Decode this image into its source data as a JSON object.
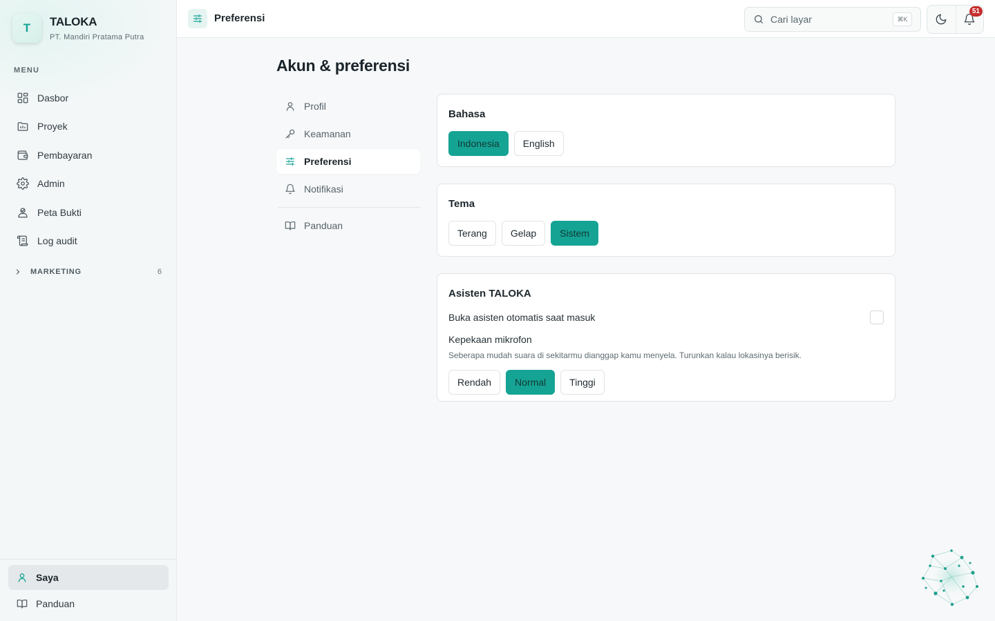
{
  "brand": {
    "initial": "T",
    "name": "TALOKA",
    "company": "PT. Mandiri Pratama Putra"
  },
  "sidebar": {
    "menu_heading": "MENU",
    "items": [
      {
        "label": "Dasbor",
        "icon": "dashboard-icon"
      },
      {
        "label": "Proyek",
        "icon": "folder-icon"
      },
      {
        "label": "Pembayaran",
        "icon": "wallet-icon"
      },
      {
        "label": "Admin",
        "icon": "gear-icon"
      },
      {
        "label": "Peta Bukti",
        "icon": "user-pin-icon"
      },
      {
        "label": "Log audit",
        "icon": "scroll-icon"
      }
    ],
    "group": {
      "label": "MARKETING",
      "count": "6"
    },
    "bottom": [
      {
        "label": "Saya",
        "icon": "user-icon",
        "active": true
      },
      {
        "label": "Panduan",
        "icon": "book-icon"
      }
    ]
  },
  "header": {
    "title": "Preferensi",
    "search_placeholder": "Cari layar",
    "search_shortcut": "⌘K",
    "notification_count": "51"
  },
  "page": {
    "title": "Akun & preferensi",
    "subnav": [
      {
        "label": "Profil",
        "icon": "user-icon"
      },
      {
        "label": "Keamanan",
        "icon": "key-icon"
      },
      {
        "label": "Preferensi",
        "icon": "sliders-icon",
        "active": true
      },
      {
        "label": "Notifikasi",
        "icon": "bell-icon"
      }
    ],
    "subnav_extra": {
      "label": "Panduan",
      "icon": "book-icon"
    }
  },
  "cards": {
    "language": {
      "title": "Bahasa",
      "options": [
        "Indonesia",
        "English"
      ],
      "selected": "Indonesia"
    },
    "theme": {
      "title": "Tema",
      "options": [
        "Terang",
        "Gelap",
        "Sistem"
      ],
      "selected": "Sistem"
    },
    "assistant": {
      "title": "Asisten TALOKA",
      "auto_open_label": "Buka asisten otomatis saat masuk",
      "auto_open_checked": false,
      "mic_label": "Kepekaan mikrofon",
      "mic_hint": "Seberapa mudah suara di sekitarmu dianggap kamu menyela. Turunkan kalau lokasinya berisik.",
      "mic_options": [
        "Rendah",
        "Normal",
        "Tinggi"
      ],
      "mic_selected": "Normal"
    }
  },
  "colors": {
    "accent": "#15a394",
    "badge": "#c52c2c",
    "background": "#f6f8f9"
  }
}
